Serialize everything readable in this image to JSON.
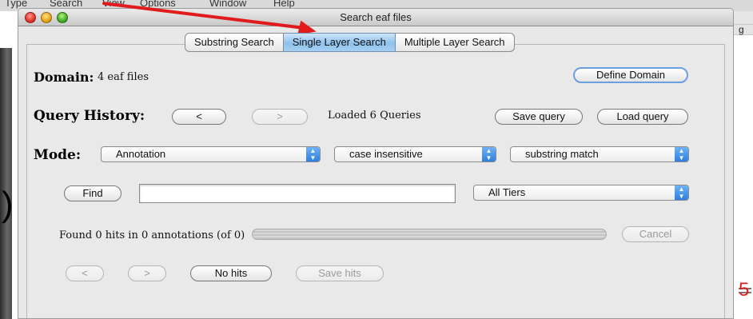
{
  "background": {
    "menubar": [
      "Type",
      "Search",
      "View",
      "Options",
      "Window",
      "Help"
    ],
    "right_partial_char": "g",
    "left_bracket": ")",
    "slide_number": "5"
  },
  "window": {
    "title": "Search eaf files"
  },
  "tabs": [
    {
      "label": "Substring Search",
      "selected": false
    },
    {
      "label": "Single Layer Search",
      "selected": true
    },
    {
      "label": "Multiple Layer Search",
      "selected": false
    }
  ],
  "domain": {
    "label": "Domain:",
    "value": "4 eaf files",
    "define_button": "Define Domain"
  },
  "query_history": {
    "label": "Query History:",
    "prev_button": "<",
    "next_button": ">",
    "status": "Loaded 6 Queries",
    "save_button": "Save query",
    "load_button": "Load query"
  },
  "mode": {
    "label": "Mode:",
    "type_select": "Annotation",
    "case_select": "case insensitive",
    "match_select": "substring match"
  },
  "find": {
    "button": "Find",
    "input_value": "",
    "tier_select": "All Tiers"
  },
  "results": {
    "status": "Found 0 hits in 0 annotations (of 0)",
    "cancel_button": "Cancel",
    "prev_button": "<",
    "next_button": ">",
    "hits_button": "No hits",
    "save_hits_button": "Save hits"
  },
  "colors": {
    "accent_tab": "#8ec1ec",
    "annotation_arrow": "#e11b1b",
    "slide_number": "#e02020",
    "select_arrow": "#2d7fe0"
  }
}
